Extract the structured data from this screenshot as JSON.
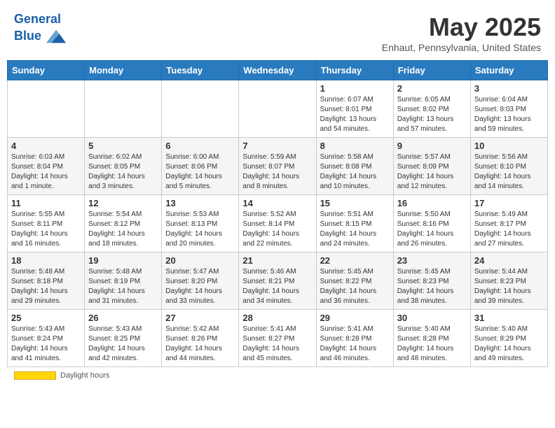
{
  "header": {
    "logo_line1": "General",
    "logo_line2": "Blue",
    "month_title": "May 2025",
    "subtitle": "Enhaut, Pennsylvania, United States"
  },
  "days_of_week": [
    "Sunday",
    "Monday",
    "Tuesday",
    "Wednesday",
    "Thursday",
    "Friday",
    "Saturday"
  ],
  "weeks": [
    [
      {
        "day": "",
        "info": ""
      },
      {
        "day": "",
        "info": ""
      },
      {
        "day": "",
        "info": ""
      },
      {
        "day": "",
        "info": ""
      },
      {
        "day": "1",
        "info": "Sunrise: 6:07 AM\nSunset: 8:01 PM\nDaylight: 13 hours\nand 54 minutes."
      },
      {
        "day": "2",
        "info": "Sunrise: 6:05 AM\nSunset: 8:02 PM\nDaylight: 13 hours\nand 57 minutes."
      },
      {
        "day": "3",
        "info": "Sunrise: 6:04 AM\nSunset: 8:03 PM\nDaylight: 13 hours\nand 59 minutes."
      }
    ],
    [
      {
        "day": "4",
        "info": "Sunrise: 6:03 AM\nSunset: 8:04 PM\nDaylight: 14 hours\nand 1 minute."
      },
      {
        "day": "5",
        "info": "Sunrise: 6:02 AM\nSunset: 8:05 PM\nDaylight: 14 hours\nand 3 minutes."
      },
      {
        "day": "6",
        "info": "Sunrise: 6:00 AM\nSunset: 8:06 PM\nDaylight: 14 hours\nand 5 minutes."
      },
      {
        "day": "7",
        "info": "Sunrise: 5:59 AM\nSunset: 8:07 PM\nDaylight: 14 hours\nand 8 minutes."
      },
      {
        "day": "8",
        "info": "Sunrise: 5:58 AM\nSunset: 8:08 PM\nDaylight: 14 hours\nand 10 minutes."
      },
      {
        "day": "9",
        "info": "Sunrise: 5:57 AM\nSunset: 8:09 PM\nDaylight: 14 hours\nand 12 minutes."
      },
      {
        "day": "10",
        "info": "Sunrise: 5:56 AM\nSunset: 8:10 PM\nDaylight: 14 hours\nand 14 minutes."
      }
    ],
    [
      {
        "day": "11",
        "info": "Sunrise: 5:55 AM\nSunset: 8:11 PM\nDaylight: 14 hours\nand 16 minutes."
      },
      {
        "day": "12",
        "info": "Sunrise: 5:54 AM\nSunset: 8:12 PM\nDaylight: 14 hours\nand 18 minutes."
      },
      {
        "day": "13",
        "info": "Sunrise: 5:53 AM\nSunset: 8:13 PM\nDaylight: 14 hours\nand 20 minutes."
      },
      {
        "day": "14",
        "info": "Sunrise: 5:52 AM\nSunset: 8:14 PM\nDaylight: 14 hours\nand 22 minutes."
      },
      {
        "day": "15",
        "info": "Sunrise: 5:51 AM\nSunset: 8:15 PM\nDaylight: 14 hours\nand 24 minutes."
      },
      {
        "day": "16",
        "info": "Sunrise: 5:50 AM\nSunset: 8:16 PM\nDaylight: 14 hours\nand 26 minutes."
      },
      {
        "day": "17",
        "info": "Sunrise: 5:49 AM\nSunset: 8:17 PM\nDaylight: 14 hours\nand 27 minutes."
      }
    ],
    [
      {
        "day": "18",
        "info": "Sunrise: 5:48 AM\nSunset: 8:18 PM\nDaylight: 14 hours\nand 29 minutes."
      },
      {
        "day": "19",
        "info": "Sunrise: 5:48 AM\nSunset: 8:19 PM\nDaylight: 14 hours\nand 31 minutes."
      },
      {
        "day": "20",
        "info": "Sunrise: 5:47 AM\nSunset: 8:20 PM\nDaylight: 14 hours\nand 33 minutes."
      },
      {
        "day": "21",
        "info": "Sunrise: 5:46 AM\nSunset: 8:21 PM\nDaylight: 14 hours\nand 34 minutes."
      },
      {
        "day": "22",
        "info": "Sunrise: 5:45 AM\nSunset: 8:22 PM\nDaylight: 14 hours\nand 36 minutes."
      },
      {
        "day": "23",
        "info": "Sunrise: 5:45 AM\nSunset: 8:23 PM\nDaylight: 14 hours\nand 38 minutes."
      },
      {
        "day": "24",
        "info": "Sunrise: 5:44 AM\nSunset: 8:23 PM\nDaylight: 14 hours\nand 39 minutes."
      }
    ],
    [
      {
        "day": "25",
        "info": "Sunrise: 5:43 AM\nSunset: 8:24 PM\nDaylight: 14 hours\nand 41 minutes."
      },
      {
        "day": "26",
        "info": "Sunrise: 5:43 AM\nSunset: 8:25 PM\nDaylight: 14 hours\nand 42 minutes."
      },
      {
        "day": "27",
        "info": "Sunrise: 5:42 AM\nSunset: 8:26 PM\nDaylight: 14 hours\nand 44 minutes."
      },
      {
        "day": "28",
        "info": "Sunrise: 5:41 AM\nSunset: 8:27 PM\nDaylight: 14 hours\nand 45 minutes."
      },
      {
        "day": "29",
        "info": "Sunrise: 5:41 AM\nSunset: 8:28 PM\nDaylight: 14 hours\nand 46 minutes."
      },
      {
        "day": "30",
        "info": "Sunrise: 5:40 AM\nSunset: 8:28 PM\nDaylight: 14 hours\nand 48 minutes."
      },
      {
        "day": "31",
        "info": "Sunrise: 5:40 AM\nSunset: 8:29 PM\nDaylight: 14 hours\nand 49 minutes."
      }
    ]
  ],
  "footer": {
    "legend_label": "Daylight hours"
  }
}
